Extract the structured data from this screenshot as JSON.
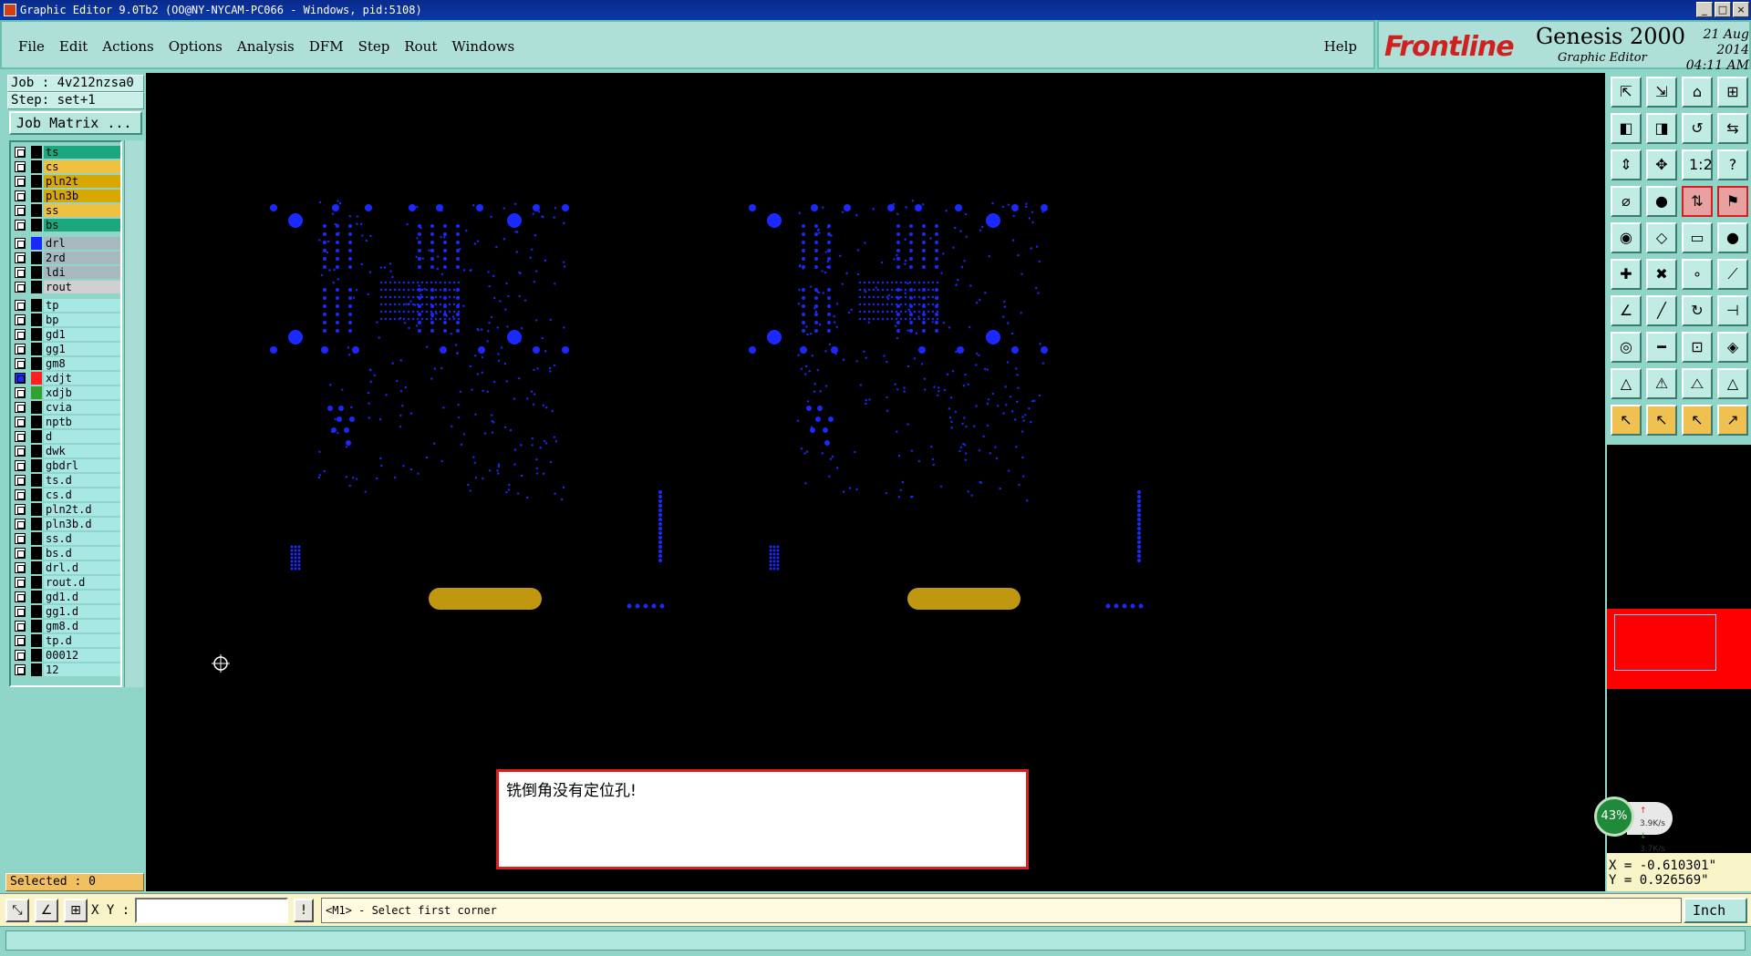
{
  "window": {
    "title": "Graphic Editor 9.0Tb2 (OO@NY-NYCAM-PC066 - Windows, pid:5108)"
  },
  "menu": {
    "items": [
      "File",
      "Edit",
      "Actions",
      "Options",
      "Analysis",
      "DFM",
      "Step",
      "Rout",
      "Windows"
    ],
    "help": "Help"
  },
  "brand": {
    "logo": "Frontline",
    "product": "Genesis 2000",
    "subtitle": "Graphic Editor",
    "date": "21 Aug 2014",
    "time": "04:11 AM"
  },
  "job": {
    "job_label": "Job : 4v212nzsa0",
    "step_label": "Step: set+1",
    "matrix_button": "Job Matrix ..."
  },
  "layers": [
    {
      "name": "ts",
      "color": "#1aa87c"
    },
    {
      "name": "cs",
      "color": "#f0c040"
    },
    {
      "name": "pln2t",
      "color": "#d8a800"
    },
    {
      "name": "pln3b",
      "color": "#d8a800"
    },
    {
      "name": "ss",
      "color": "#f0c040"
    },
    {
      "name": "bs",
      "color": "#1aa87c"
    },
    {
      "name": "drl",
      "color": "#a8b8c0",
      "swatch": "#1a2aff"
    },
    {
      "name": "2rd",
      "color": "#a8b8c0"
    },
    {
      "name": "ldi",
      "color": "#a8b8c0"
    },
    {
      "name": "rout",
      "color": "#d0d0d0"
    },
    {
      "name": "tp",
      "color": "#a8e8e4"
    },
    {
      "name": "bp",
      "color": "#a8e8e4"
    },
    {
      "name": "gd1",
      "color": "#a8e8e4"
    },
    {
      "name": "gg1",
      "color": "#a8e8e4"
    },
    {
      "name": "gm8",
      "color": "#a8e8e4"
    },
    {
      "name": "xdjt",
      "color": "#a8e8e4",
      "swatch": "#ff2020",
      "active": true
    },
    {
      "name": "xdjb",
      "color": "#a8e8e4",
      "swatch": "#30a030"
    },
    {
      "name": "cvia",
      "color": "#a8e8e4"
    },
    {
      "name": "nptb",
      "color": "#a8e8e4"
    },
    {
      "name": "d",
      "color": "#a8e8e4"
    },
    {
      "name": "dwk",
      "color": "#a8e8e4"
    },
    {
      "name": "gbdrl",
      "color": "#a8e8e4"
    },
    {
      "name": "ts.d",
      "color": "#a8e8e4"
    },
    {
      "name": "cs.d",
      "color": "#a8e8e4"
    },
    {
      "name": "pln2t.d",
      "color": "#a8e8e4"
    },
    {
      "name": "pln3b.d",
      "color": "#a8e8e4"
    },
    {
      "name": "ss.d",
      "color": "#a8e8e4"
    },
    {
      "name": "bs.d",
      "color": "#a8e8e4"
    },
    {
      "name": "drl.d",
      "color": "#a8e8e4"
    },
    {
      "name": "rout.d",
      "color": "#a8e8e4"
    },
    {
      "name": "gd1.d",
      "color": "#a8e8e4"
    },
    {
      "name": "gg1.d",
      "color": "#a8e8e4"
    },
    {
      "name": "gm8.d",
      "color": "#a8e8e4"
    },
    {
      "name": "tp.d",
      "color": "#a8e8e4"
    },
    {
      "name": "00012",
      "color": "#a8e8e4"
    },
    {
      "name": "12",
      "color": "#a8e8e4"
    }
  ],
  "selected": "Selected : 0",
  "dialog": {
    "message": "铣倒角没有定位孔!"
  },
  "coords": {
    "x": "X = -0.610301\"",
    "y": "Y =  0.926569\""
  },
  "network": {
    "percent": "43%",
    "up": "3.9K/s",
    "down": "3.7K/s"
  },
  "bottom": {
    "xy_label": "X Y :",
    "prompt": "<M1> - Select first corner",
    "units": "Inch",
    "info_button": "!"
  },
  "colors": {
    "drill": "#1a2aff",
    "rout_slot": "#c09810",
    "canvas": "#000000"
  },
  "toolbar_icons": [
    "zoom-home-icon",
    "zoom-in-icon",
    "zoom-out-icon",
    "home-icon",
    "pan-icon",
    "window-icon",
    "layout-icon",
    "help-icon",
    "grid-icon",
    "measure-icon",
    "snap-icon",
    "query-icon",
    "feature-icon",
    "select-icon",
    "move-icon",
    "rotate-icon",
    "copy-icon",
    "mirror-icon",
    "arc-icon",
    "line-icon",
    "pad-icon",
    "slot-icon",
    "surface-icon",
    "text-icon",
    "delete-icon",
    "edit-icon",
    "hole-icon",
    "route-icon",
    "cursor-icon",
    "select-touch-icon",
    "select-point-icon",
    "route-select-icon"
  ]
}
